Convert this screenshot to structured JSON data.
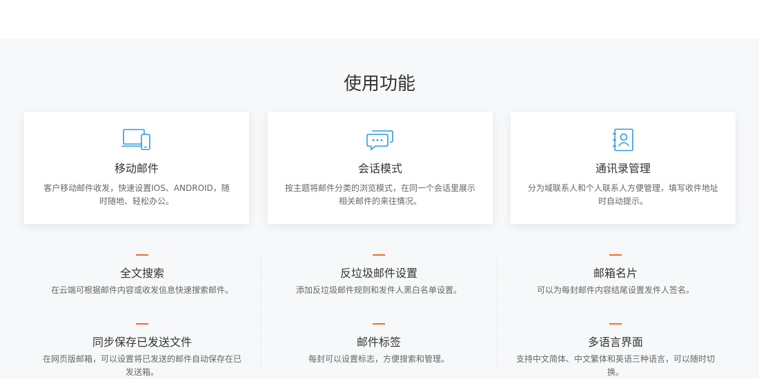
{
  "section": {
    "title": "使用功能"
  },
  "cards": [
    {
      "icon": "devices-icon",
      "title": "移动邮件",
      "desc": "客户移动邮件收发，快速设置IOS、ANDROID，随时随地、轻松办公。"
    },
    {
      "icon": "chat-bubbles-icon",
      "title": "会话模式",
      "desc": "按主题将邮件分类的浏览模式，在同一个会话里展示相关邮件的来往情况。"
    },
    {
      "icon": "contact-book-icon",
      "title": "通讯录管理",
      "desc": "分为域联系人和个人联系人方便管理，填写收件地址时自动提示。"
    }
  ],
  "features": [
    {
      "title": "全文搜索",
      "desc": "在云端可根据邮件内容或收发信息快速搜索邮件。"
    },
    {
      "title": "反垃圾邮件设置",
      "desc": "添加反垃圾邮件规则和发件人黑白名单设置。"
    },
    {
      "title": "邮箱名片",
      "desc": "可以为每封邮件内容结尾设置发件人签名。"
    },
    {
      "title": "同步保存已发送文件",
      "desc": "在网页版邮箱，可以设置将已发送的邮件自动保存在已发送箱。"
    },
    {
      "title": "邮件标签",
      "desc": "每封可以设置标志，方便搜索和管理。"
    },
    {
      "title": "多语言界面",
      "desc": "支持中文简体、中文繁体和英语三种语言，可以随时切换。"
    }
  ],
  "colors": {
    "accent": "#f36c21",
    "icon": "#2b9bd8",
    "background": "#f7f8f9",
    "card": "#ffffff"
  }
}
